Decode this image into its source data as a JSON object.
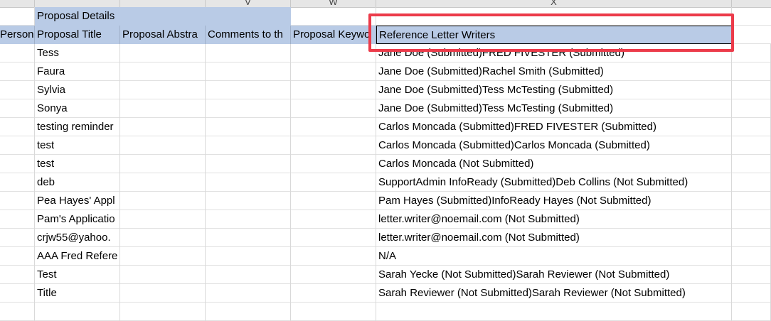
{
  "col_letters": [
    "",
    "",
    "",
    "V",
    "W",
    "X"
  ],
  "group_header": "Proposal Details",
  "headers": {
    "person": "Person'",
    "title": "Proposal Title",
    "abstract": "Proposal Abstra",
    "comments": "Comments to th",
    "keywords": "Proposal Keywo",
    "writers": "Reference Letter Writers"
  },
  "rows": [
    {
      "title": "Tess",
      "writers": "Jane Doe (Submitted)FRED FIVESTER (Submitted)"
    },
    {
      "title": "Faura",
      "writers": "Jane Doe (Submitted)Rachel Smith (Submitted)"
    },
    {
      "title": "Sylvia",
      "writers": "Jane Doe (Submitted)Tess McTesting (Submitted)"
    },
    {
      "title": "Sonya",
      "writers": "Jane Doe (Submitted)Tess McTesting (Submitted)"
    },
    {
      "title": "testing reminder",
      "writers": "Carlos Moncada (Submitted)FRED FIVESTER (Submitted)"
    },
    {
      "title": "test",
      "writers": "Carlos Moncada (Submitted)Carlos Moncada (Submitted)"
    },
    {
      "title": "test",
      "writers": "Carlos Moncada (Not Submitted)"
    },
    {
      "title": "deb",
      "writers": "SupportAdmin InfoReady (Submitted)Deb Collins (Not Submitted)"
    },
    {
      "title": "Pea Hayes' Appl",
      "writers": "Pam Hayes (Submitted)InfoReady Hayes (Not Submitted)"
    },
    {
      "title": "Pam's Applicatio",
      "writers": "letter.writer@noemail.com (Not Submitted)"
    },
    {
      "title": "crjw55@yahoo.",
      "writers": "letter.writer@noemail.com (Not Submitted)"
    },
    {
      "title": "AAA Fred Refere",
      "writers": "N/A"
    },
    {
      "title": "Test",
      "writers": "Sarah Yecke (Not Submitted)Sarah Reviewer (Not Submitted)"
    },
    {
      "title": "Title",
      "writers": "Sarah Reviewer (Not Submitted)Sarah Reviewer (Not Submitted)"
    }
  ],
  "colors": {
    "header_fill": "#b9cbe6",
    "highlight": "#ec3b4a"
  }
}
